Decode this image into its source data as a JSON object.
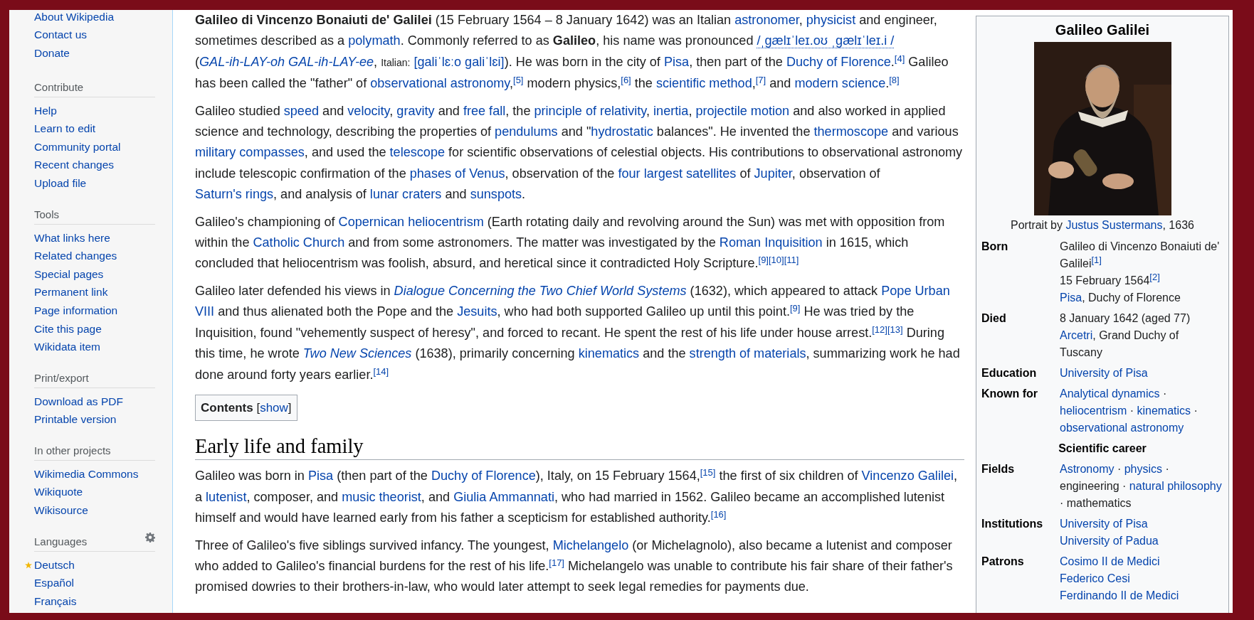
{
  "sidebar": {
    "sections": [
      {
        "items": [
          {
            "label": "About Wikipedia"
          },
          {
            "label": "Contact us"
          },
          {
            "label": "Donate"
          }
        ]
      },
      {
        "heading": "Contribute",
        "items": [
          {
            "label": "Help"
          },
          {
            "label": "Learn to edit"
          },
          {
            "label": "Community portal"
          },
          {
            "label": "Recent changes"
          },
          {
            "label": "Upload file"
          }
        ]
      },
      {
        "heading": "Tools",
        "items": [
          {
            "label": "What links here"
          },
          {
            "label": "Related changes"
          },
          {
            "label": "Special pages"
          },
          {
            "label": "Permanent link"
          },
          {
            "label": "Page information"
          },
          {
            "label": "Cite this page"
          },
          {
            "label": "Wikidata item"
          }
        ]
      },
      {
        "heading": "Print/export",
        "items": [
          {
            "label": "Download as PDF"
          },
          {
            "label": "Printable version"
          }
        ]
      },
      {
        "heading": "In other projects",
        "items": [
          {
            "label": "Wikimedia Commons"
          },
          {
            "label": "Wikiquote"
          },
          {
            "label": "Wikisource"
          }
        ]
      },
      {
        "heading": "Languages",
        "settings": true,
        "items": [
          {
            "label": "Deutsch",
            "featured": true
          },
          {
            "label": "Español",
            "featured": false
          },
          {
            "label": "Français",
            "featured": false
          }
        ]
      }
    ]
  },
  "article": {
    "blocks": [
      {
        "kind": "paragraph",
        "segments": [
          {
            "kind": "bold",
            "text": "Galileo di Vincenzo Bonaiuti de' Galilei"
          },
          {
            "kind": "text",
            "text": " (15 February 1564 – 8 January 1642) was an Italian "
          },
          {
            "kind": "link",
            "text": "astronomer"
          },
          {
            "kind": "text",
            "text": ", "
          },
          {
            "kind": "link",
            "text": "physicist"
          },
          {
            "kind": "text",
            "text": " and engineer, sometimes described as a "
          },
          {
            "kind": "link",
            "text": "polymath"
          },
          {
            "kind": "text",
            "text": ". Commonly referred to as "
          },
          {
            "kind": "bold",
            "text": "Galileo"
          },
          {
            "kind": "text",
            "text": ", his name was pronounced "
          },
          {
            "kind": "ipa",
            "text": "/ˌɡælɪˈleɪ.oʊ ˌɡælɪˈleɪ.i /"
          },
          {
            "kind": "text",
            "text": " ("
          },
          {
            "kind": "italic-link",
            "text": "GAL-ih-LAY-oh"
          },
          {
            "kind": "space"
          },
          {
            "kind": "italic-link",
            "text": "GAL-ih-LAY-ee"
          },
          {
            "kind": "text",
            "text": ", "
          },
          {
            "kind": "small",
            "text": "Italian:"
          },
          {
            "kind": "space"
          },
          {
            "kind": "link",
            "text": "[galiˈlɛːo galiˈlɛi]"
          },
          {
            "kind": "text",
            "text": "). He was born in the city of "
          },
          {
            "kind": "link",
            "text": "Pisa"
          },
          {
            "kind": "text",
            "text": ", then part of the "
          },
          {
            "kind": "link",
            "text": "Duchy of Florence"
          },
          {
            "kind": "text",
            "text": "."
          },
          {
            "kind": "ref",
            "text": "[4]"
          },
          {
            "kind": "text",
            "text": " Galileo has been called the \"father\" of "
          },
          {
            "kind": "link",
            "text": "observational astronomy"
          },
          {
            "kind": "text",
            "text": ","
          },
          {
            "kind": "ref",
            "text": "[5]"
          },
          {
            "kind": "text",
            "text": " modern physics,"
          },
          {
            "kind": "ref",
            "text": "[6]"
          },
          {
            "kind": "text",
            "text": " the "
          },
          {
            "kind": "link",
            "text": "scientific method"
          },
          {
            "kind": "text",
            "text": ","
          },
          {
            "kind": "ref",
            "text": "[7]"
          },
          {
            "kind": "text",
            "text": " and "
          },
          {
            "kind": "link",
            "text": "modern science"
          },
          {
            "kind": "text",
            "text": "."
          },
          {
            "kind": "ref",
            "text": "[8]"
          }
        ]
      },
      {
        "kind": "paragraph",
        "segments": [
          {
            "kind": "text",
            "text": "Galileo studied "
          },
          {
            "kind": "link",
            "text": "speed"
          },
          {
            "kind": "text",
            "text": " and "
          },
          {
            "kind": "link",
            "text": "velocity"
          },
          {
            "kind": "text",
            "text": ", "
          },
          {
            "kind": "link",
            "text": "gravity"
          },
          {
            "kind": "text",
            "text": " and "
          },
          {
            "kind": "link",
            "text": "free fall"
          },
          {
            "kind": "text",
            "text": ", the "
          },
          {
            "kind": "link",
            "text": "principle of relativity"
          },
          {
            "kind": "text",
            "text": ", "
          },
          {
            "kind": "link",
            "text": "inertia"
          },
          {
            "kind": "text",
            "text": ", "
          },
          {
            "kind": "link",
            "text": "projectile motion"
          },
          {
            "kind": "text",
            "text": " and also worked in applied science and technology, describing the properties of "
          },
          {
            "kind": "link",
            "text": "pendulums"
          },
          {
            "kind": "text",
            "text": " and \""
          },
          {
            "kind": "link",
            "text": "hydrostatic"
          },
          {
            "kind": "text",
            "text": " balances\". He invented the "
          },
          {
            "kind": "link",
            "text": "thermoscope"
          },
          {
            "kind": "text",
            "text": " and various "
          },
          {
            "kind": "link",
            "text": "military compasses"
          },
          {
            "kind": "text",
            "text": ", and used the "
          },
          {
            "kind": "link",
            "text": "telescope"
          },
          {
            "kind": "text",
            "text": " for scientific observations of celestial objects. His contributions to observational astronomy include telescopic confirmation of the "
          },
          {
            "kind": "link",
            "text": "phases of Venus"
          },
          {
            "kind": "text",
            "text": ", observation of the "
          },
          {
            "kind": "link",
            "text": "four largest satellites"
          },
          {
            "kind": "text",
            "text": " of "
          },
          {
            "kind": "link",
            "text": "Jupiter"
          },
          {
            "kind": "text",
            "text": ", observation of "
          },
          {
            "kind": "link",
            "text": "Saturn's rings"
          },
          {
            "kind": "text",
            "text": ", and analysis of "
          },
          {
            "kind": "link",
            "text": "lunar craters"
          },
          {
            "kind": "text",
            "text": " and "
          },
          {
            "kind": "link",
            "text": "sunspots"
          },
          {
            "kind": "text",
            "text": "."
          }
        ]
      },
      {
        "kind": "paragraph",
        "segments": [
          {
            "kind": "text",
            "text": "Galileo's championing of "
          },
          {
            "kind": "link",
            "text": "Copernican heliocentrism"
          },
          {
            "kind": "text",
            "text": " (Earth rotating daily and revolving around the Sun) was met with opposition from within the "
          },
          {
            "kind": "link",
            "text": "Catholic Church"
          },
          {
            "kind": "text",
            "text": " and from some astronomers. The matter was investigated by the "
          },
          {
            "kind": "link",
            "text": "Roman Inquisition"
          },
          {
            "kind": "text",
            "text": " in 1615, which concluded that heliocentrism was foolish, absurd, and heretical since it contradicted Holy Scripture."
          },
          {
            "kind": "ref",
            "text": "[9]"
          },
          {
            "kind": "ref",
            "text": "[10]"
          },
          {
            "kind": "ref",
            "text": "[11]"
          }
        ]
      },
      {
        "kind": "paragraph",
        "segments": [
          {
            "kind": "text",
            "text": "Galileo later defended his views in "
          },
          {
            "kind": "italic-link",
            "text": "Dialogue Concerning the Two Chief World Systems"
          },
          {
            "kind": "text",
            "text": " (1632), which appeared to attack "
          },
          {
            "kind": "link",
            "text": "Pope Urban"
          },
          {
            "kind": "space"
          },
          {
            "kind": "link",
            "text": "VIII"
          },
          {
            "kind": "text",
            "text": " and thus alienated both the Pope and the "
          },
          {
            "kind": "link",
            "text": "Jesuits"
          },
          {
            "kind": "text",
            "text": ", who had both supported Galileo up until this point."
          },
          {
            "kind": "ref",
            "text": "[9]"
          },
          {
            "kind": "text",
            "text": " He was tried by the Inquisition, found \"vehemently suspect of heresy\", and forced to recant. He spent the rest of his life under house arrest."
          },
          {
            "kind": "ref",
            "text": "[12]"
          },
          {
            "kind": "ref",
            "text": "[13]"
          },
          {
            "kind": "text",
            "text": " During this time, he wrote "
          },
          {
            "kind": "italic-link",
            "text": "Two New Sciences"
          },
          {
            "kind": "text",
            "text": " (1638), primarily concerning "
          },
          {
            "kind": "link",
            "text": "kinematics"
          },
          {
            "kind": "text",
            "text": " and the "
          },
          {
            "kind": "link",
            "text": "strength of materials"
          },
          {
            "kind": "text",
            "text": ", summarizing work he had done around forty years earlier."
          },
          {
            "kind": "ref",
            "text": "[14]"
          }
        ]
      },
      {
        "kind": "contents",
        "title": "Contents",
        "segments": [
          {
            "kind": "text",
            "text": "["
          },
          {
            "kind": "link",
            "text": "show"
          },
          {
            "kind": "text",
            "text": "]"
          }
        ]
      },
      {
        "kind": "heading",
        "text": "Early life and family"
      },
      {
        "kind": "paragraph",
        "segments": [
          {
            "kind": "text",
            "text": "Galileo was born in "
          },
          {
            "kind": "link",
            "text": "Pisa"
          },
          {
            "kind": "text",
            "text": " (then part of the "
          },
          {
            "kind": "link",
            "text": "Duchy of Florence"
          },
          {
            "kind": "text",
            "text": "), Italy, on 15 February 1564,"
          },
          {
            "kind": "ref",
            "text": "[15]"
          },
          {
            "kind": "text",
            "text": " the first of six children of "
          },
          {
            "kind": "link",
            "text": "Vincenzo"
          },
          {
            "kind": "space"
          },
          {
            "kind": "link",
            "text": "Galilei"
          },
          {
            "kind": "text",
            "text": ", a "
          },
          {
            "kind": "link",
            "text": "lutenist"
          },
          {
            "kind": "text",
            "text": ", composer, and "
          },
          {
            "kind": "link",
            "text": "music theorist"
          },
          {
            "kind": "text",
            "text": ", and "
          },
          {
            "kind": "link",
            "text": "Giulia Ammannati"
          },
          {
            "kind": "text",
            "text": ", who had married in 1562. Galileo became an accomplished lutenist himself and would have learned early from his father a scepticism for established authority."
          },
          {
            "kind": "ref",
            "text": "[16]"
          }
        ]
      },
      {
        "kind": "paragraph",
        "segments": [
          {
            "kind": "text",
            "text": "Three of Galileo's five siblings survived infancy. The youngest, "
          },
          {
            "kind": "link",
            "text": "Michelangelo"
          },
          {
            "kind": "text",
            "text": " (or Michelagnolo), also became a lutenist and composer who added to Galileo's financial burdens for the rest of his life."
          },
          {
            "kind": "ref",
            "text": "[17]"
          },
          {
            "kind": "text",
            "text": " Michelangelo was unable to contribute his fair share of their father's promised dowries to their brothers-in-law, who would later attempt to seek legal remedies for payments due."
          }
        ]
      }
    ]
  },
  "infobox": {
    "title": "Galileo Galilei",
    "caption": [
      {
        "kind": "text",
        "text": "Portrait by "
      },
      {
        "kind": "link",
        "text": "Justus Sustermans"
      },
      {
        "kind": "text",
        "text": ", 1636"
      }
    ],
    "rows": [
      {
        "kind": "row",
        "label": "Born",
        "lines": [
          [
            {
              "kind": "text",
              "text": "Galileo di Vincenzo Bonaiuti de' Galilei"
            },
            {
              "kind": "ref",
              "text": "[1]"
            }
          ],
          [
            {
              "kind": "text",
              "text": "15 February 1564"
            },
            {
              "kind": "ref",
              "text": "[2]"
            }
          ],
          [
            {
              "kind": "link",
              "text": "Pisa"
            },
            {
              "kind": "text",
              "text": ", Duchy of Florence"
            }
          ]
        ]
      },
      {
        "kind": "row",
        "label": "Died",
        "lines": [
          [
            {
              "kind": "text",
              "text": "8 January 1642 (aged 77)"
            }
          ],
          [
            {
              "kind": "link",
              "text": "Arcetri"
            },
            {
              "kind": "text",
              "text": ", Grand Duchy of Tuscany"
            }
          ]
        ]
      },
      {
        "kind": "row",
        "label": "Education",
        "lines": [
          [
            {
              "kind": "link",
              "text": "University of Pisa"
            }
          ]
        ]
      },
      {
        "kind": "row",
        "label": "Known for",
        "lines": [
          [
            {
              "kind": "link",
              "text": "Analytical dynamics"
            },
            {
              "kind": "text",
              "text": " · "
            },
            {
              "kind": "link",
              "text": "heliocentrism"
            },
            {
              "kind": "text",
              "text": " · "
            },
            {
              "kind": "link",
              "text": "kinematics"
            },
            {
              "kind": "text",
              "text": " · "
            },
            {
              "kind": "link",
              "text": "observational astronomy"
            }
          ]
        ]
      },
      {
        "kind": "header",
        "label": "Scientific career"
      },
      {
        "kind": "row",
        "label": "Fields",
        "lines": [
          [
            {
              "kind": "link",
              "text": "Astronomy"
            },
            {
              "kind": "text",
              "text": " · "
            },
            {
              "kind": "link",
              "text": "physics"
            },
            {
              "kind": "text",
              "text": " · engineering · "
            },
            {
              "kind": "link",
              "text": "natural philosophy"
            },
            {
              "kind": "text",
              "text": " · mathematics"
            }
          ]
        ]
      },
      {
        "kind": "row",
        "label": "Institutions",
        "lines": [
          [
            {
              "kind": "link",
              "text": "University of Pisa"
            }
          ],
          [
            {
              "kind": "link",
              "text": "University of Padua"
            }
          ]
        ]
      },
      {
        "kind": "row",
        "label": "Patrons",
        "lines": [
          [
            {
              "kind": "link",
              "text": "Cosimo II de Medici"
            }
          ],
          [
            {
              "kind": "link",
              "text": "Federico Cesi"
            }
          ],
          [
            {
              "kind": "link",
              "text": "Ferdinando II de Medici"
            }
          ]
        ]
      }
    ]
  }
}
